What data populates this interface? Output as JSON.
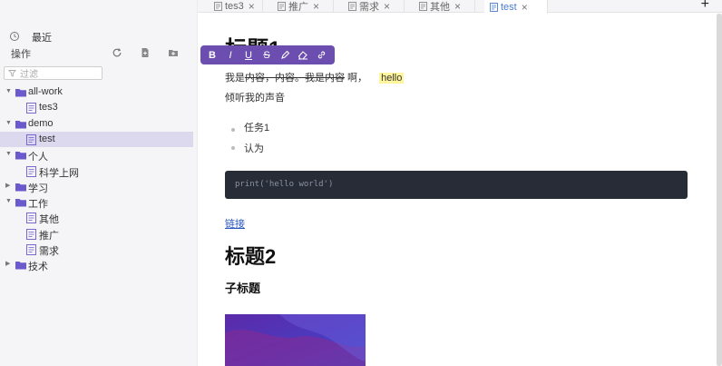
{
  "sidebar": {
    "recent_label": "最近",
    "ops_label": "操作",
    "filter_placeholder": "过滤",
    "tree": [
      {
        "type": "folder",
        "label": "all-work",
        "depth": 0,
        "expanded": true
      },
      {
        "type": "file",
        "label": "tes3",
        "depth": 1
      },
      {
        "type": "folder",
        "label": "demo",
        "depth": 0,
        "expanded": true
      },
      {
        "type": "file",
        "label": "test",
        "depth": 1,
        "selected": true
      },
      {
        "type": "folder",
        "label": "个人",
        "depth": 0,
        "expanded": true
      },
      {
        "type": "file",
        "label": "科学上网",
        "depth": 1
      },
      {
        "type": "folder",
        "label": "学习",
        "depth": 0,
        "expanded": false
      },
      {
        "type": "folder",
        "label": "工作",
        "depth": 0,
        "expanded": true
      },
      {
        "type": "file",
        "label": "其他",
        "depth": 1
      },
      {
        "type": "file",
        "label": "推广",
        "depth": 1
      },
      {
        "type": "file",
        "label": "需求",
        "depth": 1
      },
      {
        "type": "folder",
        "label": "技术",
        "depth": 0,
        "expanded": false
      }
    ]
  },
  "tabs": [
    {
      "label": "tes3",
      "active": false
    },
    {
      "label": "推广",
      "active": false
    },
    {
      "label": "需求",
      "active": false
    },
    {
      "label": "其他",
      "active": false
    },
    {
      "label": "test",
      "active": true
    }
  ],
  "toolbar_buttons": [
    "B",
    "I",
    "U",
    "S"
  ],
  "editor": {
    "h1": "标题1",
    "para1_prefix": "我是",
    "para1_strike": "内容，内容。我是内容",
    "para1_suffix": " 啊，",
    "para1_highlight": "hello",
    "para2": "倾听我的声音",
    "list": [
      "任务1",
      "认为"
    ],
    "code": "print('hello world')",
    "link": "链接",
    "h2": "标题2",
    "h3": "子标题"
  },
  "colors": {
    "accent": "#6b4eb0",
    "selected_row": "#dcd9ef",
    "folder": "#6a5acd",
    "code_bg": "#272c36",
    "highlight": "#fff59d"
  }
}
